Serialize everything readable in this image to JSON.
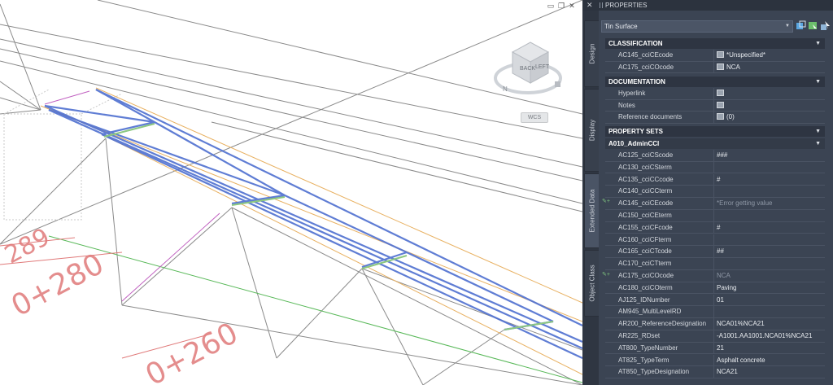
{
  "viewport": {
    "cube_labels": {
      "back": "BACK",
      "left": "LEFT",
      "north": "N"
    },
    "wcs_label": "WCS",
    "station_labels": [
      "0+280",
      "0+260",
      "289"
    ],
    "window_controls": [
      "minimize-icon",
      "restore-icon",
      "close-icon"
    ]
  },
  "panel": {
    "title": "PROPERTIES",
    "close_glyph": "✕",
    "side_tabs": [
      "Design",
      "Display",
      "Extended Data",
      "Object Class"
    ],
    "object_type": "Tin Surface",
    "sections": {
      "classification": {
        "title": "CLASSIFICATION",
        "rows": [
          {
            "key": "AC145_cciCEcode",
            "value": "*Unspecified*"
          },
          {
            "key": "AC175_cciCOcode",
            "value": "NCA"
          }
        ]
      },
      "documentation": {
        "title": "DOCUMENTATION",
        "rows": [
          {
            "key": "Hyperlink",
            "value": ""
          },
          {
            "key": "Notes",
            "value": ""
          },
          {
            "key": "Reference documents",
            "value": "(0)"
          }
        ]
      },
      "property_sets": {
        "title": "PROPERTY SETS",
        "subsection": "A010_AdminCCI",
        "rows": [
          {
            "key": "AC125_cciCScode",
            "value": "###"
          },
          {
            "key": "AC130_cciCSterm",
            "value": ""
          },
          {
            "key": "AC135_cciCCcode",
            "value": "#"
          },
          {
            "key": "AC140_cciCCterm",
            "value": ""
          },
          {
            "key": "AC145_cciCEcode",
            "value": "*Error getting value"
          },
          {
            "key": "AC150_cciCEterm",
            "value": ""
          },
          {
            "key": "AC155_cciCFcode",
            "value": "#"
          },
          {
            "key": "AC160_cciCFterm",
            "value": ""
          },
          {
            "key": "AC165_cciCTcode",
            "value": "##"
          },
          {
            "key": "AC170_cciCTterm",
            "value": ""
          },
          {
            "key": "AC175_cciCOcode",
            "value": "NCA"
          },
          {
            "key": "AC180_cciCOterm",
            "value": "Paving"
          },
          {
            "key": "AJ125_IDNumber",
            "value": "01"
          },
          {
            "key": "AM945_MultiLevelRD",
            "value": ""
          },
          {
            "key": "AR200_ReferenceDesignation",
            "value": "NCA01%NCA21"
          },
          {
            "key": "AR225_RDset",
            "value": "-A1001.AA1001.NCA01%NCA21"
          },
          {
            "key": "AT800_TypeNumber",
            "value": "21"
          },
          {
            "key": "AT825_TypeTerm",
            "value": "Asphalt concrete"
          },
          {
            "key": "AT850_TypeDesignation",
            "value": "NCA21"
          }
        ]
      }
    }
  }
}
